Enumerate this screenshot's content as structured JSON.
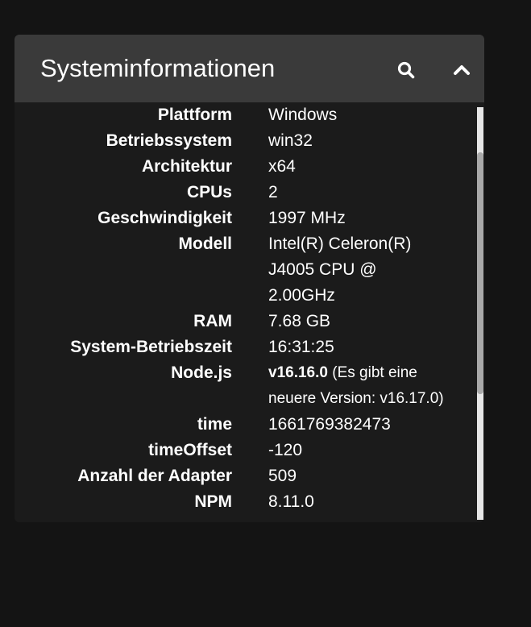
{
  "header": {
    "title": "Systeminformationen"
  },
  "rows": [
    {
      "label": "Plattform",
      "value": "Windows"
    },
    {
      "label": "Betriebssystem",
      "value": "win32"
    },
    {
      "label": "Architektur",
      "value": "x64"
    },
    {
      "label": "CPUs",
      "value": "2"
    },
    {
      "label": "Geschwindigkeit",
      "value": "1997 MHz"
    },
    {
      "label": "Modell",
      "value_lines": [
        "Intel(R) Celeron(R)",
        "J4005 CPU @",
        "2.00GHz"
      ]
    },
    {
      "label": "RAM",
      "value": "7.68 GB"
    },
    {
      "label": "System-Betriebszeit",
      "value": "16:31:25"
    },
    {
      "label": "Node.js",
      "version": "v16.16.0",
      "note_line1": "(Es gibt eine",
      "note_line2": "neuere Version: v16.17.0)"
    },
    {
      "label": "time",
      "value": "1661769382473"
    },
    {
      "label": "timeOffset",
      "value": "-120"
    },
    {
      "label": "Anzahl der Adapter",
      "value": "509"
    },
    {
      "label": "NPM",
      "value": "8.11.0"
    }
  ],
  "icons": {
    "search": "search-icon",
    "collapse": "chevron-up-icon"
  },
  "colors": {
    "page_background": "#141414",
    "header_background": "#3a3a3a",
    "panel_background": "#1b1b1b",
    "text": "#ffffff"
  }
}
